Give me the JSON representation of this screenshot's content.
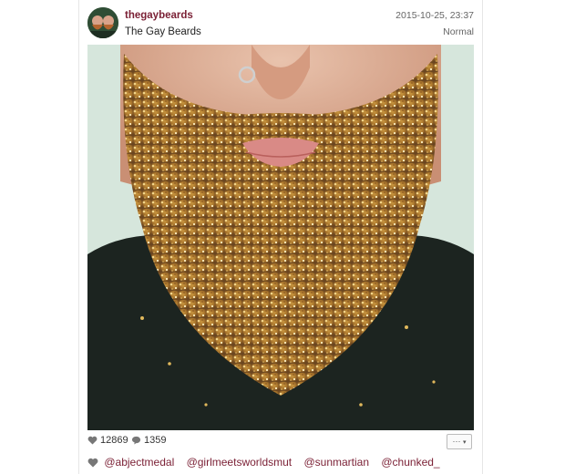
{
  "post": {
    "username": "thegaybeards",
    "full_name": "The Gay Beards",
    "timestamp": "2015-10-25, 23:37",
    "filter": "Normal",
    "likes": "12869",
    "comments": "1359",
    "more_label": "···",
    "tagged_users": [
      "@abjectmedal",
      "@girlmeetsworldsmut",
      "@sunmartian",
      "@chunked_"
    ]
  },
  "icons": {
    "like": "heart-icon",
    "comment": "comment-bubble-icon",
    "more": "ellipsis-dropdown-icon",
    "tags": "heart-icon"
  },
  "colors": {
    "username": "#7a1f34",
    "tag": "#7a1f34",
    "beard_gold": "#b8862f"
  }
}
